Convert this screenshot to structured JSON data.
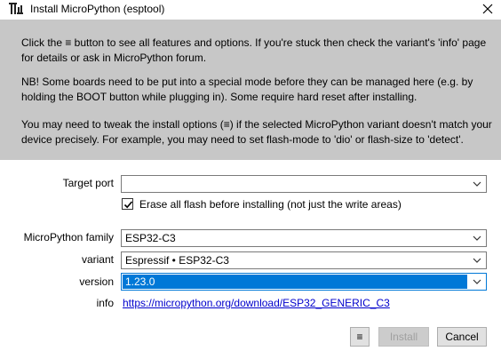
{
  "window": {
    "title": "Install MicroPython (esptool)",
    "icon": "app-logo-icon",
    "close_icon": "close-icon"
  },
  "info": {
    "paragraph1": "Click the ≡ button to see all features and options. If you're stuck then check the variant's 'info' page for details or ask in MicroPython forum.",
    "paragraph2": "NB! Some boards need to be put into a special mode before they can be managed here (e.g. by holding the BOOT button while plugging in). Some require hard reset after installing.",
    "paragraph3": "You may need to tweak the install options (≡) if the selected MicroPython variant doesn't match your device precisely. For example, you may need to set flash-mode to 'dio' or flash-size to 'detect'."
  },
  "form": {
    "target_port_label": "Target port",
    "target_port_value": "",
    "erase_checked": true,
    "erase_label": "Erase all flash before installing (not just the write areas)",
    "family_label": "MicroPython family",
    "family_value": "ESP32-C3",
    "variant_label": "variant",
    "variant_value": "Espressif • ESP32-C3",
    "version_label": "version",
    "version_value": "1.23.0",
    "info_label": "info",
    "info_link": "https://micropython.org/download/ESP32_GENERIC_C3"
  },
  "buttons": {
    "menu_label": "≡",
    "install_label": "Install",
    "cancel_label": "Cancel"
  },
  "colors": {
    "info_panel_bg": "#c7c7c7",
    "selection_blue": "#0078d7",
    "link": "#0000cc"
  }
}
